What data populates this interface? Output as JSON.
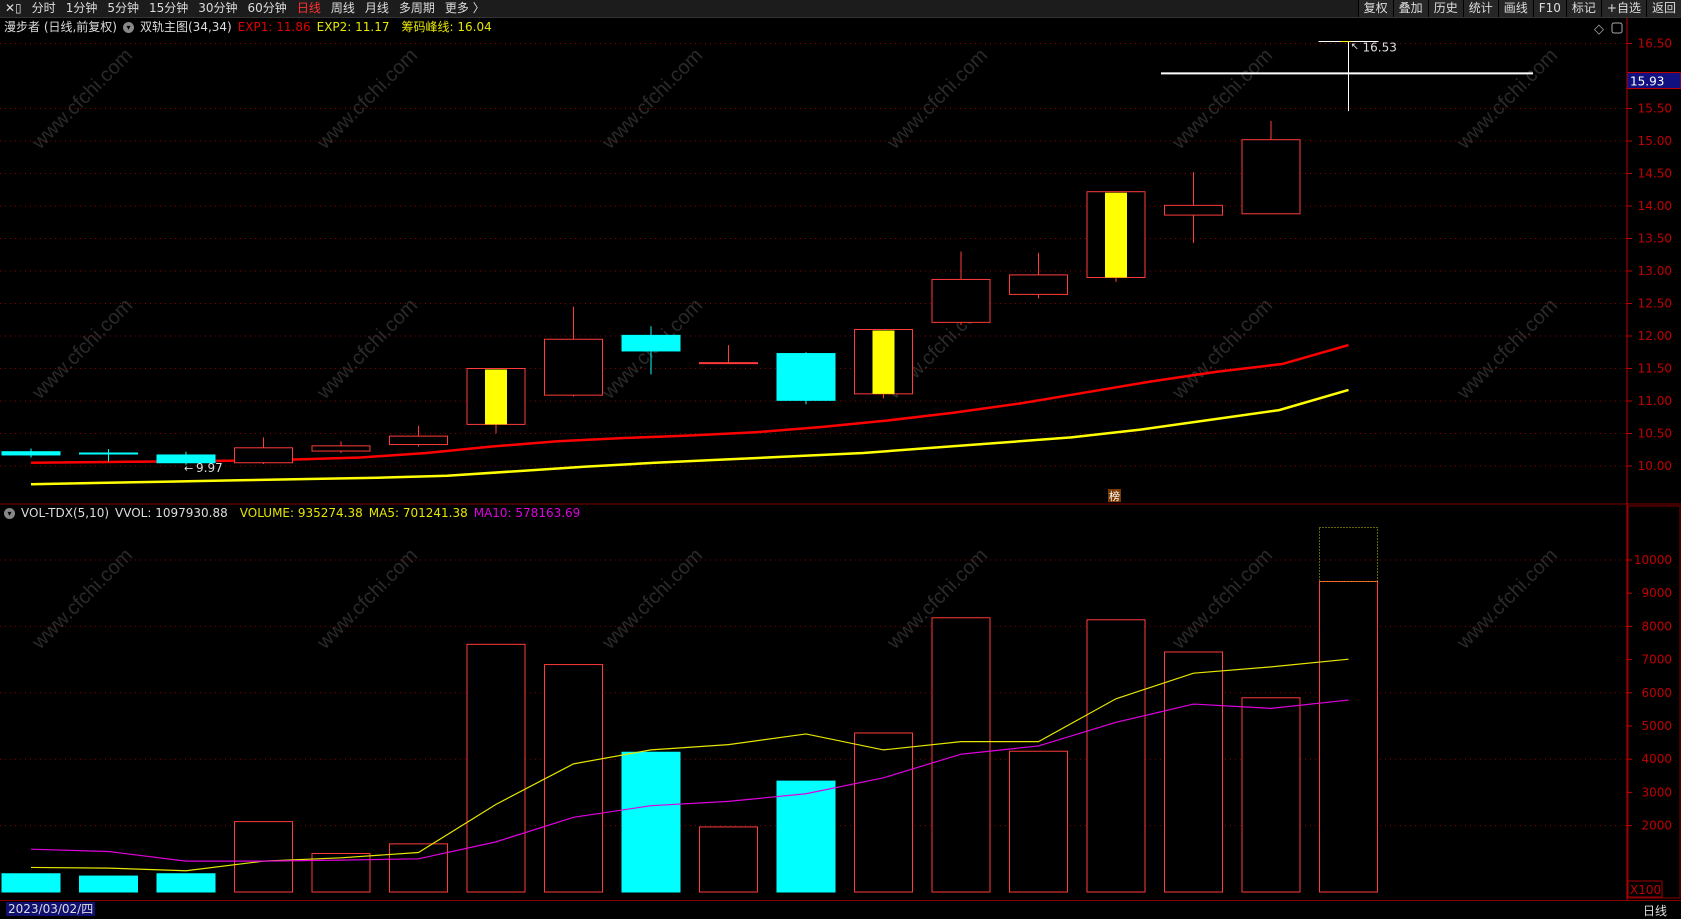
{
  "toolbar": {
    "left_items": [
      "分时",
      "1分钟",
      "5分钟",
      "15分钟",
      "30分钟",
      "60分钟",
      "日线",
      "周线",
      "月线",
      "多周期",
      "更多 〉"
    ],
    "active": "日线",
    "right_items": [
      "复权",
      "叠加",
      "历史",
      "统计",
      "画线",
      "F10",
      "标记",
      "+自选",
      "返回"
    ]
  },
  "price_legend": {
    "name": "漫步者 (日线,前复权)",
    "indicator": "双轨主图(34,34)",
    "exp1": "EXP1: 11.86",
    "exp2": "EXP2: 11.17",
    "chip": "筹码峰线: 16.04"
  },
  "volume_legend": {
    "name": "VOL-TDX(5,10)",
    "vvol": "VVOL: 1097930.88",
    "volume": "VOLUME: 935274.38",
    "ma5": "MA5: 701241.38",
    "ma10": "MA10: 578163.69"
  },
  "colors": {
    "up": "#ff3b3b",
    "down": "#00ffff",
    "exp1": "#ff0000",
    "exp2": "#ffff00",
    "ma5": "#e6e600",
    "ma10": "#e000e0",
    "axis": "#c00000",
    "grid": "#8b0000",
    "current_price_bg": "#101080"
  },
  "watermark": "www.cfchi.com",
  "badge": "榜",
  "footer": {
    "date": "2023/03/02/四",
    "period": "日线",
    "vol_unit": "X100"
  },
  "chart_data": [
    {
      "type": "candlestick",
      "y_ticks": [
        "16.50",
        "15.50",
        "15.00",
        "14.50",
        "14.00",
        "13.50",
        "13.00",
        "12.50",
        "12.00",
        "11.50",
        "11.00",
        "10.50",
        "10.00"
      ],
      "ylim": [
        9.4,
        16.85
      ],
      "current_price": "15.93",
      "high_label": "16.53",
      "low_label": "9.97",
      "chip_peak": 16.04,
      "candles": [
        {
          "o": 10.22,
          "h": 10.27,
          "l": 10.13,
          "c": 10.17
        },
        {
          "o": 10.2,
          "h": 10.26,
          "l": 10.07,
          "c": 10.19
        },
        {
          "o": 10.17,
          "h": 10.22,
          "l": 10.02,
          "c": 10.05
        },
        {
          "o": 10.05,
          "h": 10.44,
          "l": 10.03,
          "c": 10.28
        },
        {
          "o": 10.23,
          "h": 10.38,
          "l": 10.2,
          "c": 10.31
        },
        {
          "o": 10.33,
          "h": 10.62,
          "l": 10.3,
          "c": 10.46
        },
        {
          "o": 10.64,
          "h": 11.5,
          "l": 10.5,
          "c": 11.5,
          "limit": true
        },
        {
          "o": 11.09,
          "h": 12.45,
          "l": 11.07,
          "c": 11.95
        },
        {
          "o": 12.01,
          "h": 12.15,
          "l": 11.41,
          "c": 11.77
        },
        {
          "o": 11.58,
          "h": 11.86,
          "l": 11.58,
          "c": 11.59
        },
        {
          "o": 11.73,
          "h": 11.75,
          "l": 10.95,
          "c": 11.01
        },
        {
          "o": 11.11,
          "h": 12.1,
          "l": 11.04,
          "c": 12.1,
          "limit": true
        },
        {
          "o": 12.21,
          "h": 13.3,
          "l": 12.17,
          "c": 12.87
        },
        {
          "o": 12.64,
          "h": 13.28,
          "l": 12.58,
          "c": 12.94
        },
        {
          "o": 12.9,
          "h": 14.22,
          "l": 12.83,
          "c": 14.22,
          "limit": true
        },
        {
          "o": 13.86,
          "h": 14.52,
          "l": 13.43,
          "c": 14.01
        },
        {
          "o": 13.88,
          "h": 15.31,
          "l": 13.88,
          "c": 15.02
        },
        {
          "o": 15.93,
          "h": 16.53,
          "l": 15.46,
          "c": 15.93
        }
      ],
      "series": [
        {
          "name": "EXP1",
          "values": [
            10.05,
            10.06,
            10.07,
            10.08,
            10.1,
            10.13,
            10.2,
            10.3,
            10.38,
            10.43,
            10.47,
            10.52,
            10.6,
            10.7,
            10.82,
            10.96,
            11.13,
            11.3,
            11.45,
            11.57,
            11.86
          ]
        },
        {
          "name": "EXP2",
          "values": [
            9.72,
            9.74,
            9.76,
            9.78,
            9.8,
            9.82,
            9.85,
            9.92,
            9.99,
            10.05,
            10.1,
            10.15,
            10.2,
            10.28,
            10.36,
            10.44,
            10.56,
            10.71,
            10.86,
            11.17
          ]
        }
      ]
    },
    {
      "type": "bar",
      "y_ticks": [
        "10000",
        "9000",
        "8000",
        "7000",
        "6000",
        "5000",
        "4000",
        "3000",
        "2000"
      ],
      "ylim": [
        0,
        11500
      ],
      "volume": [
        550,
        480,
        550,
        2120,
        1160,
        1450,
        7460,
        6850,
        4210,
        1960,
        3340,
        4790,
        8260,
        4240,
        8200,
        7230,
        5850,
        9353
      ],
      "vvol_last": 10979,
      "series": [
        {
          "name": "MA5",
          "values": [
            740,
            720,
            640,
            930,
            1030,
            1190,
            2640,
            3860,
            4280,
            4440,
            4760,
            4280,
            4530,
            4530,
            5820,
            6590,
            6780,
            7012
          ]
        },
        {
          "name": "MA10",
          "values": [
            1290,
            1220,
            930,
            930,
            960,
            1000,
            1510,
            2250,
            2600,
            2730,
            2960,
            3440,
            4150,
            4400,
            5110,
            5660,
            5530,
            5782
          ]
        }
      ]
    }
  ]
}
